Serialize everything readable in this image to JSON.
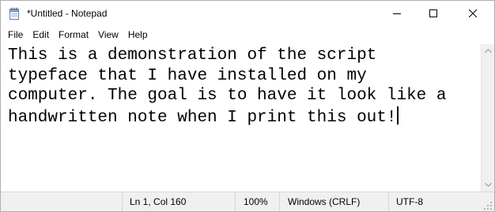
{
  "window": {
    "title": "*Untitled - Notepad",
    "icon": "notepad-icon"
  },
  "window_controls": {
    "minimize_icon": "minimize-icon",
    "maximize_icon": "maximize-icon",
    "close_icon": "close-icon"
  },
  "menu": {
    "items": [
      {
        "label": "File"
      },
      {
        "label": "Edit"
      },
      {
        "label": "Format"
      },
      {
        "label": "View"
      },
      {
        "label": "Help"
      }
    ]
  },
  "editor": {
    "lines": [
      "This is a demonstration of the script",
      "typeface that I have installed on my",
      "computer. The goal is to have it look like a",
      "handwritten note when I print this out!"
    ]
  },
  "status": {
    "position": "Ln 1, Col 160",
    "zoom": "100%",
    "line_ending": "Windows (CRLF)",
    "encoding": "UTF-8"
  },
  "colors": {
    "background": "#ffffff",
    "statusbar": "#f0f0f0",
    "text": "#000000"
  }
}
